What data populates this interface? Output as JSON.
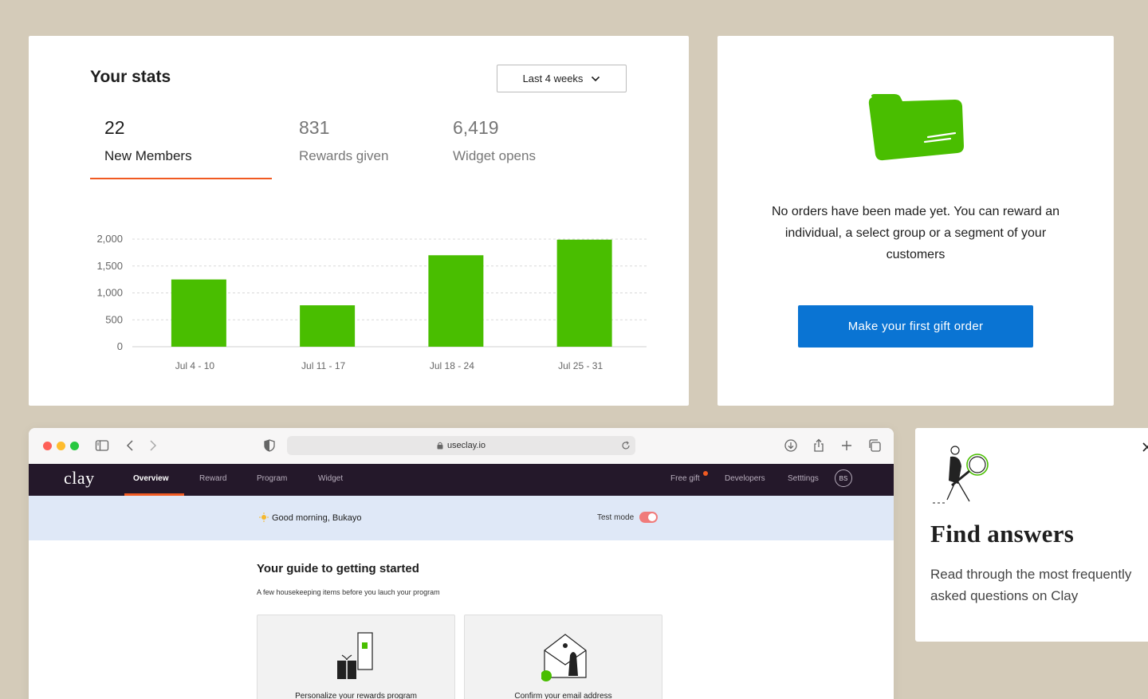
{
  "stats": {
    "title": "Your stats",
    "range_label": "Last 4 weeks",
    "metrics": [
      {
        "value": "22",
        "label": "New Members",
        "active": true
      },
      {
        "value": "831",
        "label": "Rewards given",
        "active": false
      },
      {
        "value": "6,419",
        "label": "Widget opens",
        "active": false
      }
    ]
  },
  "chart_data": {
    "type": "bar",
    "categories": [
      "Jul 4 - 10",
      "Jul 11 - 17",
      "Jul 18 - 24",
      "Jul 25 - 31"
    ],
    "values": [
      1250,
      770,
      1700,
      1990
    ],
    "yticks": [
      0,
      500,
      1000,
      1500,
      2000
    ],
    "ytick_labels": [
      "0",
      "500",
      "1,000",
      "1,500",
      "2,000"
    ],
    "ylim": [
      0,
      2000
    ],
    "title": "",
    "xlabel": "",
    "ylabel": "",
    "grid": true,
    "bar_color": "#49be00"
  },
  "orders": {
    "message": "No orders have been made yet. You can reward an individual, a select group or a segment of your customers",
    "button_label": "Make your first gift order",
    "folder_color": "#49be00",
    "button_color": "#0a74d3"
  },
  "browser": {
    "url": "useclay.io",
    "app": {
      "logo": "clay",
      "nav": [
        {
          "label": "Overview",
          "active": true
        },
        {
          "label": "Reward",
          "active": false
        },
        {
          "label": "Program",
          "active": false
        },
        {
          "label": "Widget",
          "active": false
        }
      ],
      "right_nav": [
        "Free gift",
        "Developers",
        "Setttings"
      ],
      "avatar": "BS",
      "greeting": "Good morning, Bukayo",
      "test_mode_label": "Test mode",
      "test_mode_on": true,
      "guide_title": "Your guide to getting started",
      "guide_subtitle": "A few housekeeping items before you lauch your program",
      "tasks": [
        "Personalize your rewards program",
        "Confirm your email address"
      ]
    }
  },
  "faq": {
    "title": "Find answers",
    "body": "Read through the most frequently asked questions on Clay"
  }
}
